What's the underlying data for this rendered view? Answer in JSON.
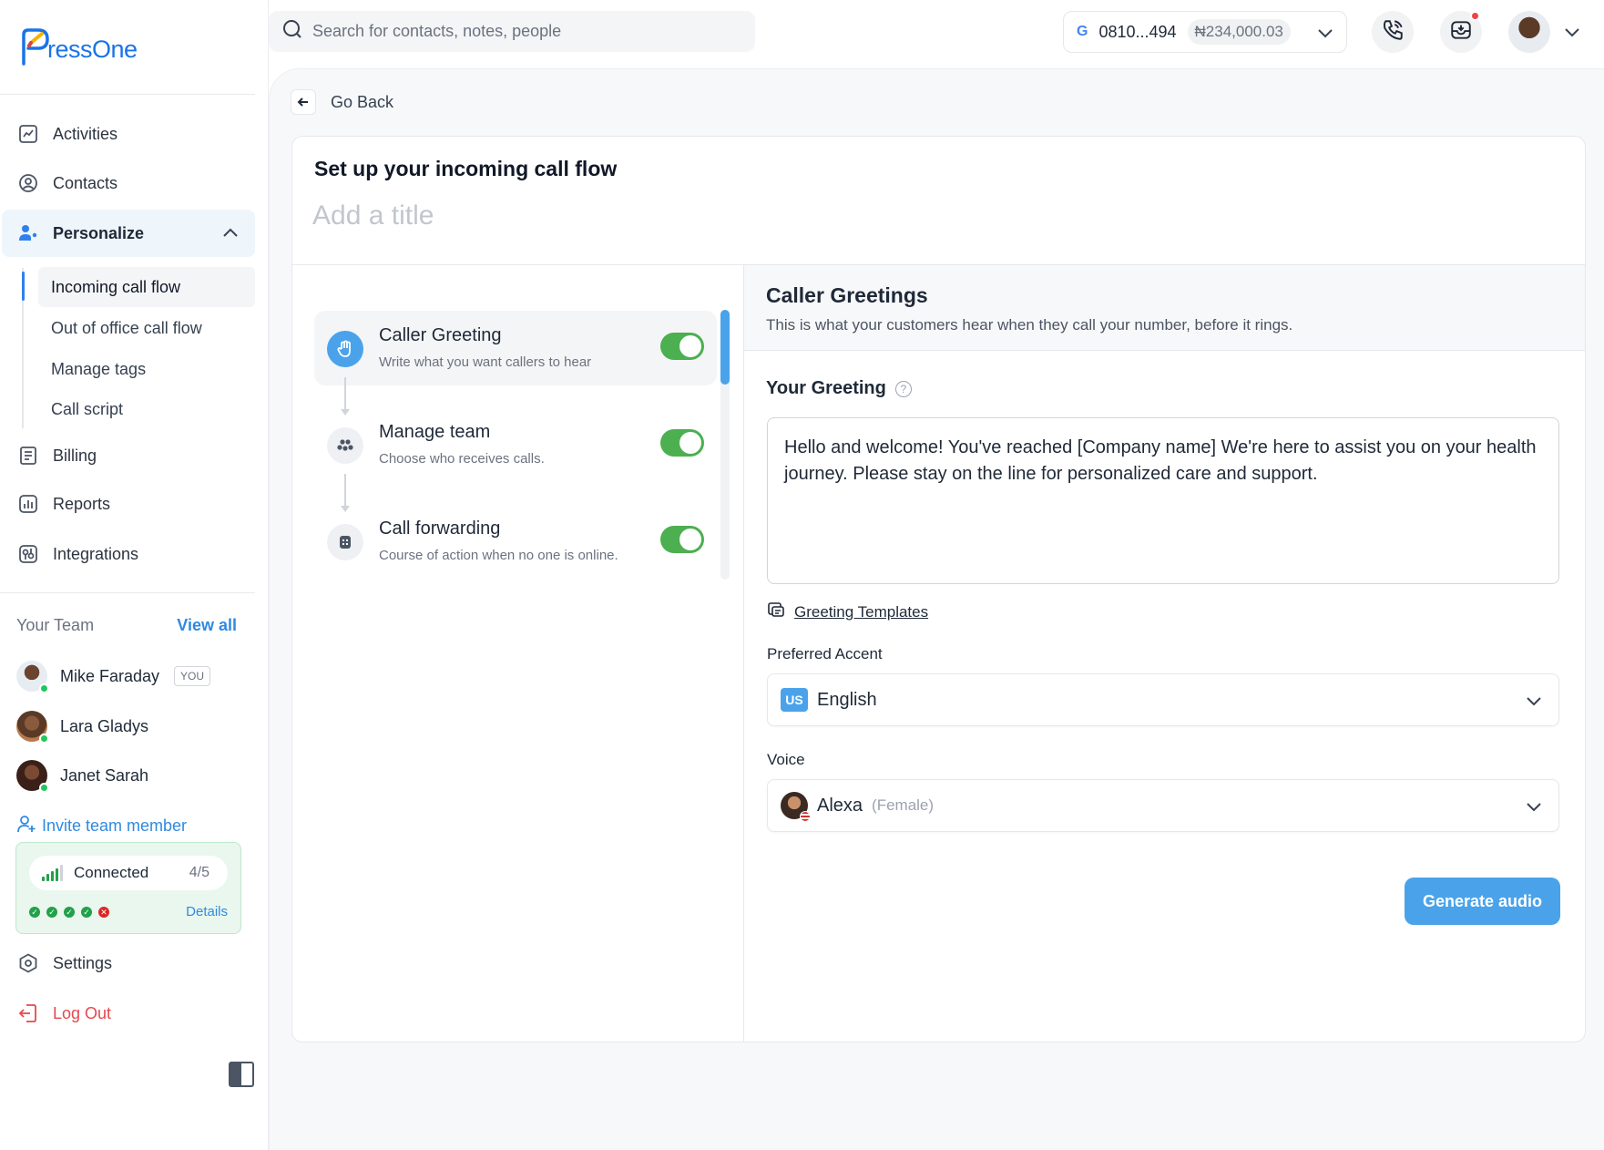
{
  "brand": {
    "name": "ressOne",
    "accent": "#2f80ed",
    "logo_letter": "P"
  },
  "sidebar": {
    "nav": [
      {
        "label": "Activities",
        "icon": "activity-chart-icon"
      },
      {
        "label": "Contacts",
        "icon": "user-circle-icon"
      },
      {
        "label": "Personalize",
        "icon": "user-settings-icon",
        "expanded": true
      }
    ],
    "personalize_sub": [
      {
        "label": "Incoming call flow",
        "active": true
      },
      {
        "label": "Out of office call flow"
      },
      {
        "label": "Manage tags"
      },
      {
        "label": "Call script"
      }
    ],
    "nav_bottom": [
      {
        "label": "Billing",
        "icon": "receipt-icon"
      },
      {
        "label": "Reports",
        "icon": "bar-chart-icon"
      },
      {
        "label": "Integrations",
        "icon": "integrations-icon"
      }
    ],
    "team": {
      "heading": "Your Team",
      "view_all": "View all",
      "members": [
        {
          "name": "Mike Faraday",
          "badge": "YOU",
          "online": true
        },
        {
          "name": "Lara Gladys",
          "online": true
        },
        {
          "name": "Janet Sarah",
          "online": true
        }
      ],
      "invite": "Invite team member"
    },
    "connection": {
      "status": "Connected",
      "count": "4/5",
      "details": "Details",
      "lines": [
        "ok",
        "ok",
        "ok",
        "ok",
        "error"
      ]
    },
    "settings": "Settings",
    "logout": "Log Out"
  },
  "topbar": {
    "search_placeholder": "Search for contacts, notes, people",
    "account_number": "0810...494",
    "balance": "₦234,000.03"
  },
  "page": {
    "back": "Go Back",
    "title": "Set up your incoming call flow",
    "title_placeholder": "Add a title",
    "steps": [
      {
        "title": "Caller Greeting",
        "desc": "Write what you want callers to hear",
        "enabled": true,
        "active": true
      },
      {
        "title": "Manage team",
        "desc": "Choose who receives calls.",
        "enabled": true
      },
      {
        "title": "Call forwarding",
        "desc": "Course of action when no one is online.",
        "enabled": true
      }
    ],
    "panel": {
      "title": "Caller Greetings",
      "subtitle": "This is what your customers hear when they call your number, before it rings.",
      "greeting_label": "Your Greeting",
      "greeting_text": "Hello and welcome! You've reached [Company name] We're here to assist you on your health journey. Please stay on the line for personalized care and support.",
      "templates_link": "Greeting Templates",
      "accent_label": "Preferred Accent",
      "accent_code": "US",
      "accent_value": "English",
      "voice_label": "Voice",
      "voice_value": "Alexa",
      "voice_gender": "(Female)",
      "generate": "Generate audio"
    }
  }
}
